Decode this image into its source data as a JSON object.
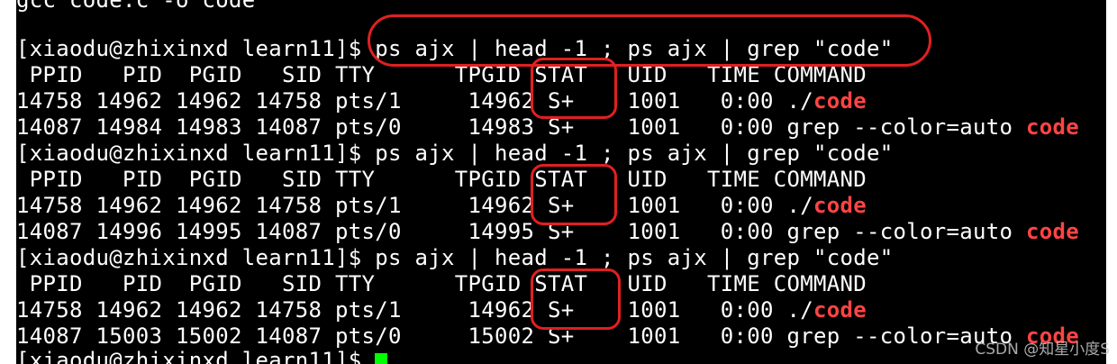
{
  "terminal": {
    "partial_top": "gcc code.c -o code",
    "prompt": "[xiaodu@zhixinxd learn11]$ ",
    "command": "ps ajx | head -1 ; ps ajx | grep \"code\"",
    "header": " PPID   PID  PGID   SID TTY      TPGID STAT   UID   TIME COMMAND",
    "blocks": [
      {
        "proc_prefix": "14758 14962 14962 14758 pts/1     14962 S+    1001   0:00 ./",
        "proc_hl": "code",
        "grep_prefix": "14087 14984 14983 14087 pts/0     14983 S+    1001   0:00 grep --color=auto ",
        "grep_hl": "code"
      },
      {
        "proc_prefix": "14758 14962 14962 14758 pts/1     14962 S+    1001   0:00 ./",
        "proc_hl": "code",
        "grep_prefix": "14087 14996 14995 14087 pts/0     14995 S+    1001   0:00 grep --color=auto ",
        "grep_hl": "code"
      },
      {
        "proc_prefix": "14758 14962 14962 14758 pts/1     14962 S+    1001   0:00 ./",
        "proc_hl": "code",
        "grep_prefix": "14087 15003 15002 14087 pts/0     15002 S+    1001   0:00 grep --color=auto ",
        "grep_hl": "code"
      }
    ],
    "final_prompt": "[xiaodu@zhixinxd learn11]$ "
  },
  "colors": {
    "background": "#000000",
    "text": "#ffffff",
    "highlight": "#ff4444",
    "cursor": "#00ff00",
    "annotation": "#e02020"
  },
  "watermark": "CSDN @知星小度S"
}
